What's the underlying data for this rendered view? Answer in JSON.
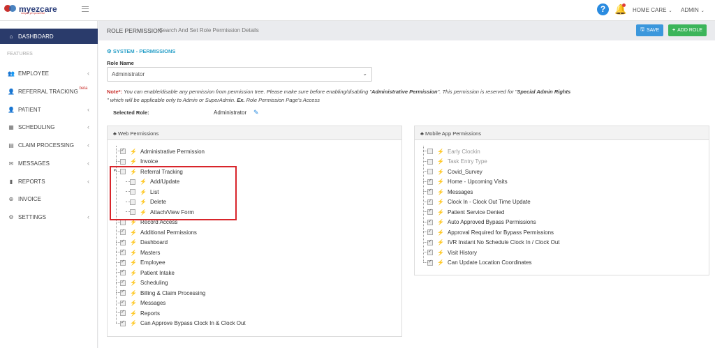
{
  "app": {
    "logo_text": "myezcare",
    "logo_tagline": "simple yet powerful"
  },
  "topbar": {
    "home_care": "HOME CARE",
    "admin": "ADMIN"
  },
  "sidebar": {
    "section_label": "FEATURES",
    "items": [
      {
        "label": "DASHBOARD",
        "icon": "home-icon"
      },
      {
        "label": "EMPLOYEE",
        "icon": "users-icon"
      },
      {
        "label": "REFERRAL TRACKING",
        "badge": "beta",
        "icon": "user-icon"
      },
      {
        "label": "PATIENT",
        "icon": "user-icon"
      },
      {
        "label": "SCHEDULING",
        "icon": "calendar-icon"
      },
      {
        "label": "CLAIM PROCESSING",
        "icon": "file-icon"
      },
      {
        "label": "MESSAGES",
        "icon": "envelope-icon"
      },
      {
        "label": "REPORTS",
        "icon": "bar-chart-icon"
      },
      {
        "label": "INVOICE",
        "icon": "invoice-icon"
      },
      {
        "label": "SETTINGS",
        "icon": "gear-icon"
      }
    ]
  },
  "header": {
    "title": "ROLE PERMISSION",
    "subtitle": "Search And Set Role Permission Details",
    "save_label": "SAVE",
    "add_role_label": "ADD ROLE"
  },
  "main": {
    "section_title": "SYSTEM - PERMISSIONS",
    "role_name_label": "Role Name",
    "role_name_value": "Administrator",
    "note": {
      "prefix": "Note*:",
      "text1": " You can enable/disable any permission from permission tree. Please make sure before enabling/disabling \"",
      "bold1": "Administrative Permission",
      "text2": "\". This permission is reserved for \"",
      "bold2": "Special Admin Rights",
      "text3": "\" which will be applicable only to Admin or SuperAdmin. ",
      "bold3": "Ex.",
      "text4": " Role Permission Page's Access"
    },
    "selected_role_label": "Selected Role:",
    "selected_role_value": "Administrator"
  },
  "web_permissions": {
    "title": "Web Permissions",
    "items": [
      {
        "label": "Administrative Permission",
        "checked": true,
        "level": 0
      },
      {
        "label": "Invoice",
        "checked": false,
        "level": 0
      },
      {
        "label": "Referral Tracking",
        "checked": false,
        "level": 0,
        "expanded": true
      },
      {
        "label": "Add/Update",
        "checked": false,
        "level": 1
      },
      {
        "label": "List",
        "checked": false,
        "level": 1
      },
      {
        "label": "Delete",
        "checked": false,
        "level": 1
      },
      {
        "label": "Attach/View Form",
        "checked": false,
        "level": 1
      },
      {
        "label": "Record Access",
        "checked": false,
        "level": 0
      },
      {
        "label": "Additional Permissions",
        "checked": true,
        "level": 0
      },
      {
        "label": "Dashboard",
        "checked": true,
        "level": 0
      },
      {
        "label": "Masters",
        "checked": true,
        "level": 0
      },
      {
        "label": "Employee",
        "checked": true,
        "level": 0
      },
      {
        "label": "Patient Intake",
        "checked": true,
        "level": 0
      },
      {
        "label": "Scheduling",
        "checked": true,
        "level": 0
      },
      {
        "label": "Billing & Claim Processing",
        "checked": true,
        "level": 0
      },
      {
        "label": "Messages",
        "checked": true,
        "level": 0
      },
      {
        "label": "Reports",
        "checked": true,
        "level": 0
      },
      {
        "label": "Can Approve Bypass Clock In & Clock Out",
        "checked": true,
        "level": 0
      }
    ]
  },
  "mobile_permissions": {
    "title": "Mobile App Permissions",
    "items": [
      {
        "label": "Early Clockin",
        "checked": false,
        "muted": true
      },
      {
        "label": "Task Entry Type",
        "checked": false,
        "muted": true
      },
      {
        "label": "Covid_Survey",
        "checked": false,
        "muted": false
      },
      {
        "label": "Home - Upcoming Visits",
        "checked": true,
        "muted": false
      },
      {
        "label": "Messages",
        "checked": true,
        "muted": false
      },
      {
        "label": "Clock In - Clock Out Time Update",
        "checked": true,
        "muted": false
      },
      {
        "label": "Patient Service Denied",
        "checked": true,
        "muted": false
      },
      {
        "label": "Auto Approved Bypass Permissions",
        "checked": true,
        "muted": false
      },
      {
        "label": "Approval Required for Bypass Permissions",
        "checked": true,
        "muted": false
      },
      {
        "label": "IVR Instant No Schedule Clock In / Clock Out",
        "checked": true,
        "muted": false
      },
      {
        "label": "Visit History",
        "checked": true,
        "muted": false
      },
      {
        "label": "Can Update Location Coordinates",
        "checked": true,
        "muted": false
      }
    ]
  },
  "colors": {
    "sidebar_active": "#2a3b6b",
    "save_btn": "#3b97dc",
    "add_btn": "#3cb55a",
    "accent": "#2aa0c8",
    "highlight": "#d8252b"
  }
}
